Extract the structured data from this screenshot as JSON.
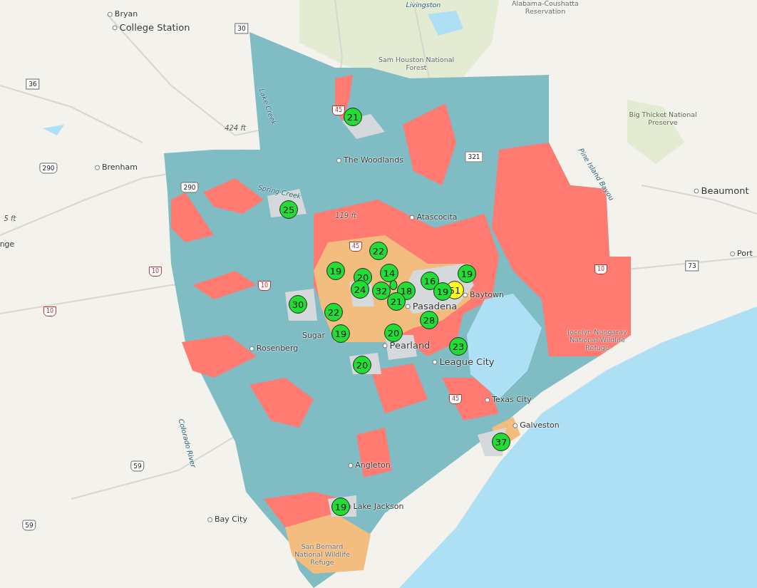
{
  "map": {
    "places": [
      {
        "text": "Bryan",
        "kind": "city"
      },
      {
        "text": "College Station",
        "kind": "bigcity"
      },
      {
        "text": "Livingston",
        "kind": "water"
      },
      {
        "text": "Alabama-Coushatta Reservation",
        "kind": "area"
      },
      {
        "text": "Sam Houston National Forest",
        "kind": "area"
      },
      {
        "text": "Big Thicket National Preserve",
        "kind": "park"
      },
      {
        "text": "Beaumont",
        "kind": "bigcity"
      },
      {
        "text": "Port",
        "kind": "city"
      },
      {
        "text": "Brenham",
        "kind": "city"
      },
      {
        "text": "424 ft",
        "kind": "peak"
      },
      {
        "text": "The Woodlands",
        "kind": "city"
      },
      {
        "text": "119 ft",
        "kind": "peak"
      },
      {
        "text": "Atascocita",
        "kind": "city"
      },
      {
        "text": "Spring Creek",
        "kind": "water"
      },
      {
        "text": "Lake Creek",
        "kind": "water"
      },
      {
        "text": "Baytown",
        "kind": "city"
      },
      {
        "text": "Pasadena",
        "kind": "bigcity"
      },
      {
        "text": "Sugar",
        "kind": "plain"
      },
      {
        "text": "Rosenberg",
        "kind": "city"
      },
      {
        "text": "Pearland",
        "kind": "bigcity"
      },
      {
        "text": "League City",
        "kind": "bigcity"
      },
      {
        "text": "Texas City",
        "kind": "city"
      },
      {
        "text": "Galveston",
        "kind": "city"
      },
      {
        "text": "Jocelyn Nungaray National Wildlife Refuge",
        "kind": "area"
      },
      {
        "text": "Angleton",
        "kind": "city"
      },
      {
        "text": "Lake Jackson",
        "kind": "city"
      },
      {
        "text": "Bay City",
        "kind": "city"
      },
      {
        "text": "San Bernard National Wildlife Refuge",
        "kind": "area"
      },
      {
        "text": "Colorado River",
        "kind": "water"
      },
      {
        "text": "Pine Island Bayou",
        "kind": "water"
      },
      {
        "text": "nge",
        "kind": "plain"
      },
      {
        "text": "5 ft",
        "kind": "peak"
      }
    ],
    "route_shields": [
      {
        "number": "30",
        "kind": "state"
      },
      {
        "number": "36",
        "kind": "state"
      },
      {
        "number": "290",
        "kind": "us"
      },
      {
        "number": "45",
        "kind": "interstate"
      },
      {
        "number": "290",
        "kind": "us"
      },
      {
        "number": "321",
        "kind": "state"
      },
      {
        "number": "45",
        "kind": "interstate"
      },
      {
        "number": "10",
        "kind": "interstate"
      },
      {
        "number": "10",
        "kind": "interstate"
      },
      {
        "number": "10",
        "kind": "interstate"
      },
      {
        "number": "10",
        "kind": "interstate"
      },
      {
        "number": "73",
        "kind": "state"
      },
      {
        "number": "45",
        "kind": "interstate"
      },
      {
        "number": "59",
        "kind": "us"
      },
      {
        "number": "59",
        "kind": "us"
      }
    ],
    "clusters": [
      {
        "count": "21",
        "color": "#22dd33"
      },
      {
        "count": "25",
        "color": "#22dd33"
      },
      {
        "count": "22",
        "color": "#22dd33"
      },
      {
        "count": "19",
        "color": "#22dd33"
      },
      {
        "count": "20",
        "color": "#22dd33"
      },
      {
        "count": "14",
        "color": "#22dd33"
      },
      {
        "color": "#22dd33"
      },
      {
        "count": "24",
        "color": "#22dd33"
      },
      {
        "count": "32",
        "color": "#22dd33"
      },
      {
        "count": "18",
        "color": "#22dd33"
      },
      {
        "count": "21",
        "color": "#22dd33"
      },
      {
        "count": "16",
        "color": "#22dd33"
      },
      {
        "count": "19",
        "color": "#22dd33"
      },
      {
        "count": "51",
        "color": "#ffff22"
      },
      {
        "count": "19",
        "color": "#22dd33"
      },
      {
        "count": "30",
        "color": "#22dd33"
      },
      {
        "count": "22",
        "color": "#22dd33"
      },
      {
        "count": "28",
        "color": "#22dd33"
      },
      {
        "count": "19",
        "color": "#22dd33"
      },
      {
        "count": "20",
        "color": "#22dd33"
      },
      {
        "count": "23",
        "color": "#22dd33"
      },
      {
        "count": "20",
        "color": "#22dd33"
      },
      {
        "count": "37",
        "color": "#22dd33"
      },
      {
        "count": "19",
        "color": "#22dd33"
      }
    ]
  }
}
